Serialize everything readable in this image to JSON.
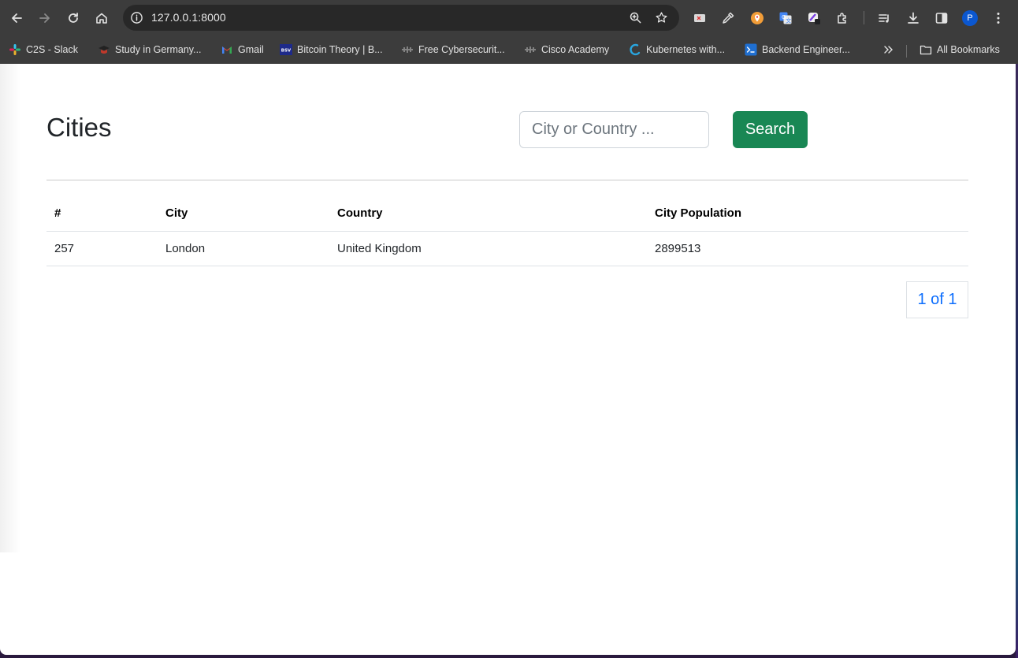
{
  "browser": {
    "url": "127.0.0.1:8000",
    "avatar_letter": "P",
    "bookmarks": [
      {
        "label": "C2S - Slack",
        "icon": "slack-icon"
      },
      {
        "label": "Study in Germany...",
        "icon": "graduation-cap-icon"
      },
      {
        "label": "Gmail",
        "icon": "gmail-icon"
      },
      {
        "label": "Bitcoin Theory | B...",
        "icon": "bsv-icon",
        "icon_text": "BSV"
      },
      {
        "label": "Free Cybersecurit...",
        "icon": "cisco-icon"
      },
      {
        "label": "Cisco Academy",
        "icon": "cisco-icon"
      },
      {
        "label": "Kubernetes with...",
        "icon": "kubernetes-icon"
      },
      {
        "label": "Backend Engineer...",
        "icon": "terminal-icon"
      }
    ],
    "all_bookmarks_label": "All Bookmarks"
  },
  "page": {
    "title": "Cities",
    "search": {
      "placeholder": "City or Country ...",
      "value": "",
      "button_label": "Search"
    },
    "table": {
      "columns": [
        "#",
        "City",
        "Country",
        "City Population"
      ],
      "rows": [
        {
          "id": "257",
          "city": "London",
          "country": "United Kingdom",
          "population": "2899513"
        }
      ]
    },
    "pagination": "1 of 1"
  },
  "colors": {
    "search_button": "#198754",
    "pager_link": "#0d6efd",
    "chrome_bg": "#3c3c3c"
  }
}
